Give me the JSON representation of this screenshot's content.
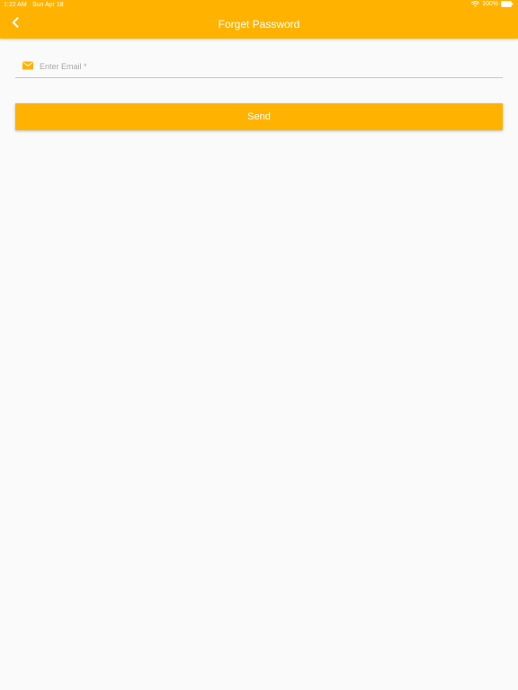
{
  "status_bar": {
    "time": "1:22 AM",
    "date": "Sun Apr 18",
    "battery": "100%",
    "wifi_icon": "wifi-icon",
    "battery_icon": "battery-icon"
  },
  "header": {
    "title": "Forget Password",
    "back_icon": "chevron-left-icon"
  },
  "form": {
    "email_placeholder": "Enter Email *",
    "email_value": "",
    "email_icon": "mail-icon",
    "send_label": "Send"
  },
  "colors": {
    "accent": "#ffb300",
    "background": "#fafafa",
    "text_on_accent": "#ffffff",
    "placeholder": "#a8a8a8"
  }
}
